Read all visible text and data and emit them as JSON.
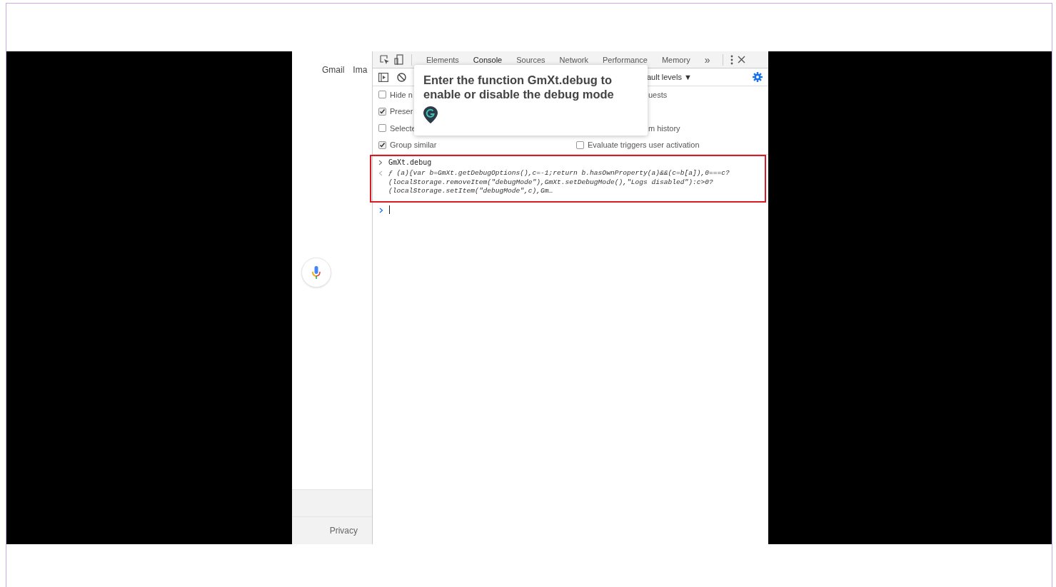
{
  "google_panel": {
    "links": [
      "Gmail",
      "Ima"
    ],
    "footer_link": "Privacy"
  },
  "devtools": {
    "tabs": [
      {
        "label": "Elements",
        "selected": false
      },
      {
        "label": "Console",
        "selected": true
      },
      {
        "label": "Sources",
        "selected": false
      },
      {
        "label": "Network",
        "selected": false
      },
      {
        "label": "Performance",
        "selected": false
      },
      {
        "label": "Memory",
        "selected": false
      }
    ],
    "more_tabs": "»",
    "levels_dropdown": "ault levels ▼",
    "settings_left": [
      {
        "label": "Hide n",
        "checked": false
      },
      {
        "label": "Preser",
        "checked": true
      },
      {
        "label": "Selecte",
        "checked": false
      },
      {
        "label": "Group similar",
        "checked": true
      }
    ],
    "settings_right": [
      {
        "label": "uests",
        "kind": "text"
      },
      {
        "kind": "empty"
      },
      {
        "label": "m history",
        "kind": "text"
      },
      {
        "label": "Evaluate triggers user activation",
        "kind": "checkbox",
        "checked": false
      }
    ],
    "console": {
      "input": "GmXt.debug",
      "output_lines": [
        "ƒ (a){var b=GmXt.getDebugOptions(),c=-1;return b.hasOwnProperty(a)&&(c=b[a]),0===c?",
        "(localStorage.removeItem(\"debugMode\"),GmXt.setDebugMode(),\"Logs disabled\"):c>0?",
        "(localStorage.setItem(\"debugMode\",c),Gm…"
      ]
    }
  },
  "tooltip": {
    "text": "Enter the function GmXt.debug to enable or disable the debug mode"
  }
}
